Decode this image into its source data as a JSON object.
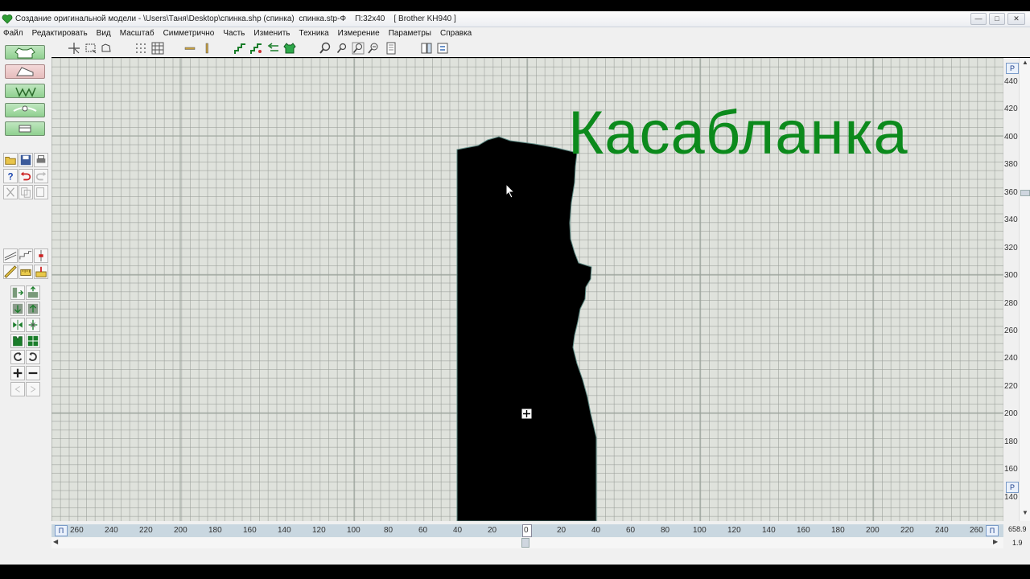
{
  "window": {
    "title": "Создание оригинальной модели - \\Users\\Таня\\Desktop\\спинка.shp (спинка)  спинка.stp-Ф    П:32x40    [ Brother KH940 ]",
    "buttons": [
      "minimize",
      "maximize",
      "close"
    ]
  },
  "menu": [
    "Файл",
    "Редактировать",
    "Вид",
    "Масштаб",
    "Симметрично",
    "Часть",
    "Изменить",
    "Техника",
    "Измерение",
    "Параметры",
    "Справка"
  ],
  "toolbar_icons": [
    "cursor-cross-icon",
    "select-rect-icon",
    "lasso-icon",
    "dot-grid-icon",
    "grid-icon",
    "horizontal-line-icon",
    "vertical-line-icon",
    "stairs-icon",
    "stairs-alt-icon",
    "arrow-left-icon",
    "garment-icon",
    "zoom-icon",
    "zoom-out-icon",
    "zoom-fit-icon",
    "zoom-page-icon",
    "page-left-icon",
    "page-right-icon"
  ],
  "left_panel": {
    "mode_buttons": [
      "sweater-icon",
      "sleeve-icon",
      "front-back-icon",
      "collar-icon",
      "pocket-icon"
    ],
    "tools": [
      "open-icon",
      "save-icon",
      "print-icon",
      "help-icon",
      "undo-icon",
      "redo-icon",
      "cut-icon",
      "copy-icon",
      "paste-icon",
      "shape-line-icon",
      "curve-icon",
      "marker-icon",
      "ruler-icon",
      "measure-icon",
      "scale-icon",
      "flip-h-icon",
      "flip-v-icon",
      "move-down-icon",
      "move-up-icon",
      "mirror-icon",
      "multiply-icon",
      "rotate-left-icon",
      "rotate-right-icon",
      "add-icon",
      "remove-icon",
      "prev-icon",
      "next-icon"
    ]
  },
  "canvas": {
    "watermark": "Касабланка"
  },
  "vertical_ruler": {
    "labels": [
      "440",
      "420",
      "400",
      "380",
      "360",
      "340",
      "320",
      "300",
      "280",
      "260",
      "240",
      "220",
      "200",
      "180",
      "160",
      "140"
    ],
    "top_badge": "P",
    "bottom_badge": "P"
  },
  "horizontal_ruler": {
    "labels": [
      "260",
      "240",
      "220",
      "200",
      "180",
      "160",
      "140",
      "120",
      "100",
      "80",
      "60",
      "40",
      "20",
      "0",
      "20",
      "40",
      "60",
      "80",
      "100",
      "120",
      "140",
      "160",
      "180",
      "200",
      "220",
      "240",
      "260"
    ],
    "left_badge": "П",
    "right_badge": "П"
  },
  "readouts": {
    "x": "658.9",
    "y": "1.9"
  },
  "colors": {
    "grid_bg": "#dfe2dc",
    "shape": "#000000",
    "watermark": "#0c8a1c"
  }
}
